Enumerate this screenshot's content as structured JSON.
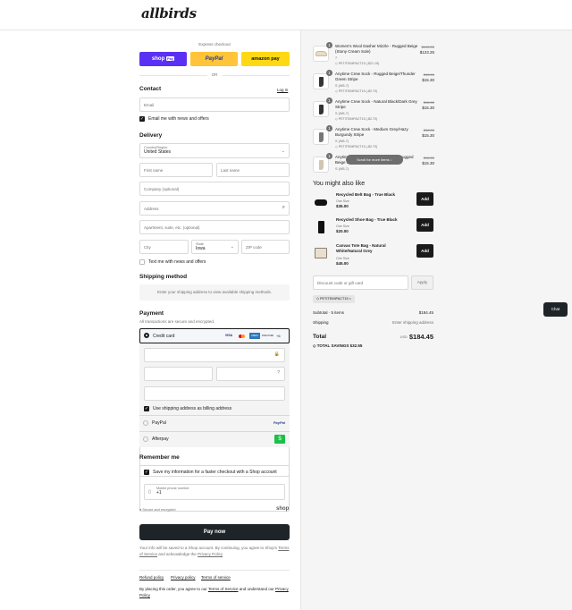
{
  "brand": {
    "logo": "allbirds"
  },
  "express": {
    "label": "Express checkout",
    "shop_pay": "shop",
    "shop_pay_suffix": "Pay",
    "paypal": "PayPal",
    "amazon": "amazon pay",
    "or": "OR"
  },
  "contact": {
    "title": "Contact",
    "login": "Log in",
    "email_placeholder": "Email",
    "news_label": "Email me with news and offers"
  },
  "delivery": {
    "title": "Delivery",
    "country_label": "Country/Region",
    "country_value": "United States",
    "first_name": "First name",
    "last_name": "Last name",
    "company": "Company (optional)",
    "address": "Address",
    "apartment": "Apartment, suite, etc. (optional)",
    "city": "City",
    "state_label": "State",
    "state_value": "Iowa",
    "zip": "ZIP code",
    "text_label": "Text me with news and offers"
  },
  "shipping": {
    "title": "Shipping method",
    "notice": "Enter your shipping address to view available shipping methods."
  },
  "payment": {
    "title": "Payment",
    "subtitle": "All transactions are secure and encrypted.",
    "credit_card": "Credit card",
    "card_brands": [
      "VISA",
      "MC",
      "AMEX",
      "DISCOVER",
      "+6"
    ],
    "billing_label": "Use shipping address as billing address",
    "paypal": "PayPal",
    "afterpay": "Afterpay"
  },
  "remember": {
    "title": "Remember me",
    "save_label": "Save my information for a faster checkout with a Shop account",
    "phone_label": "Mobile phone number",
    "phone_value": "+1",
    "secure": "Secure and encrypted",
    "shop": "shop"
  },
  "pay_now": "Pay now",
  "disclaimer": {
    "line1": "Your info will be saved to a Shop account. By continuing, you agree to Shop's",
    "terms": "Terms of Service",
    "and": "and acknowledge the",
    "privacy": "Privacy Policy"
  },
  "footer_links": [
    "Refund policy",
    "Privacy policy",
    "Terms of service"
  ],
  "footer_text": {
    "a": "By placing this order, you agree to our",
    "terms": "Terms of Service",
    "b": "and understand our",
    "privacy": "Privacy Policy"
  },
  "cart": [
    {
      "qty": "1",
      "name": "Women's Wool Dasher Mizzle - Rugged Beige (Stony Cream Sole)",
      "variant": "7",
      "code": "PETITEIMPACT15 (-$21.15)",
      "orig": "$140.00",
      "price": "$123.25",
      "kind": "shoe"
    },
    {
      "qty": "1",
      "name": "Anytime Crew Sock - Rugged Beige/Thunder Green Stripe",
      "variant": "S (W5-7)",
      "code": "PETITEIMPACT15 (-$2.70)",
      "orig": "$18.00",
      "price": "$15.30",
      "kind": "sock"
    },
    {
      "qty": "1",
      "name": "Anytime Crew Sock - Natural Black/Dark Grey Stripe",
      "variant": "S (W5-7)",
      "code": "PETITEIMPACT15 (-$2.70)",
      "orig": "$18.00",
      "price": "$15.30",
      "kind": "sock"
    },
    {
      "qty": "1",
      "name": "Anytime Crew Sock - Medium Grey/Hazy Burgundy Stripe",
      "variant": "S (W5-7)",
      "code": "PETITEIMPACT15 (-$2.70)",
      "orig": "$18.00",
      "price": "$15.30",
      "kind": "sock"
    },
    {
      "qty": "1",
      "name": "Anytime Crew Sock - Natural White/Rugged Beige Stripe",
      "variant": "S (W5-7)",
      "code": "",
      "orig": "$18.00",
      "price": "$15.30",
      "kind": "sock"
    }
  ],
  "scroll_hint": "Scroll for more items",
  "upsell": {
    "title": "You might also like",
    "add": "Add",
    "items": [
      {
        "name": "Recycled Belt Bag - True Black",
        "size": "One Size",
        "price": "$35.00"
      },
      {
        "name": "Recycled Shoe Bag - True Black",
        "size": "One Size",
        "price": "$20.00"
      },
      {
        "name": "Canvas Tote Bag - Natural White/Natural Grey",
        "size": "One Size",
        "price": "$45.00"
      }
    ]
  },
  "discount": {
    "placeholder": "Discount code or gift card",
    "apply": "Apply",
    "tag": "PETITEIMPACT15"
  },
  "summary": {
    "subtotal_label": "Subtotal · 5 items",
    "subtotal": "$184.45",
    "shipping_label": "Shipping",
    "shipping": "Enter shipping address",
    "total_label": "Total",
    "currency": "USD",
    "total": "$184.45",
    "savings_label": "TOTAL SAVINGS",
    "savings": "$32.55"
  },
  "chat": "Chat"
}
